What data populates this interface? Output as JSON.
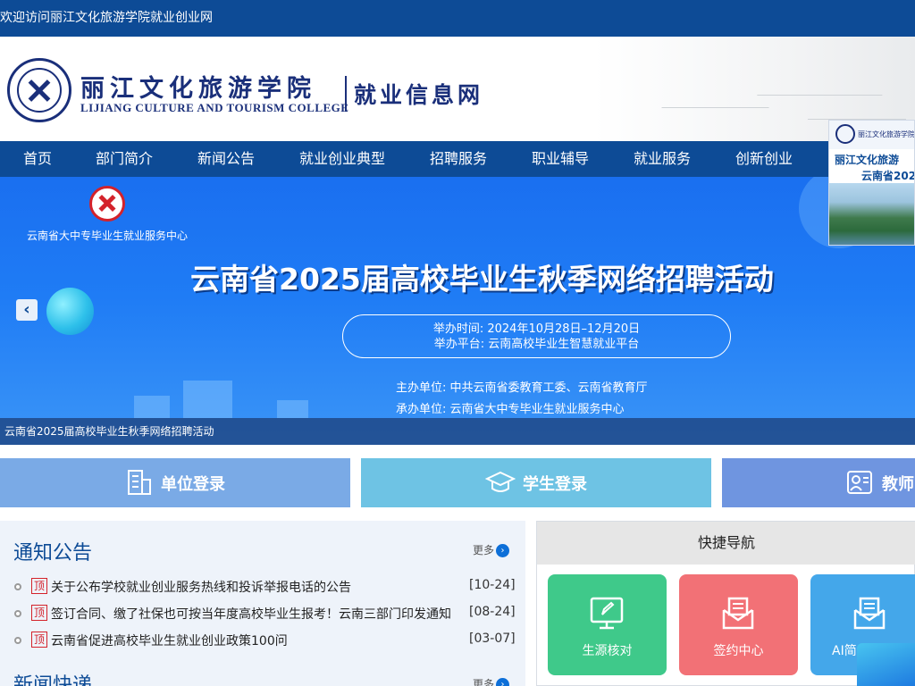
{
  "topbar": {
    "welcome": "欢迎访问丽江文化旅游学院就业创业网"
  },
  "header": {
    "school_cn": "丽江文化旅游学院",
    "school_en": "LIJIANG CULTURE AND TOURISM COLLEGE",
    "site_name": "就业信息网"
  },
  "nav": {
    "items": [
      {
        "label": "首页"
      },
      {
        "label": "部门简介"
      },
      {
        "label": "新闻公告"
      },
      {
        "label": "就业创业典型"
      },
      {
        "label": "招聘服务"
      },
      {
        "label": "职业辅导"
      },
      {
        "label": "就业服务"
      },
      {
        "label": "创新创业"
      }
    ]
  },
  "banner": {
    "org_name": "云南省大中专毕业生就业服务中心",
    "title": "云南省2025届高校毕业生秋季网络招聘活动",
    "time_line": "举办时间: 2024年10月28日–12月20日",
    "platform_line": "举办平台: 云南高校毕业生智慧就业平台",
    "host_line": "主办单位: 中共云南省委教育工委、云南省教育厅",
    "organizer_line": "承办单位: 云南省大中专毕业生就业服务中心",
    "caption": "云南省2025届高校毕业生秋季网络招聘活动",
    "prev_arrow": "‹"
  },
  "side_ad": {
    "mini_name": "丽江文化旅游学院",
    "line1": "丽江文化旅游",
    "line2": "云南省202"
  },
  "login": {
    "unit": {
      "label": "单位登录",
      "color": "#7aaae6"
    },
    "student": {
      "label": "学生登录",
      "color": "#6ec3e4"
    },
    "teacher": {
      "label": "教师",
      "color": "#6f95e0"
    }
  },
  "notices": {
    "title": "通知公告",
    "more": "更多",
    "items": [
      {
        "tag": "顶",
        "text": "关于公布学校就业创业服务热线和投诉举报电话的公告",
        "date": "[10-24]"
      },
      {
        "tag": "顶",
        "text": "签订合同、缴了社保也可按当年度高校毕业生报考！云南三部门印发通知",
        "date": "[08-24]"
      },
      {
        "tag": "顶",
        "text": "云南省促进高校毕业生就业创业政策100问",
        "date": "[03-07]"
      }
    ]
  },
  "news": {
    "title": "新闻快递",
    "more": "更多"
  },
  "quick_nav": {
    "title": "快捷导航",
    "tiles": [
      {
        "label": "生源核对",
        "color": "#3fc98a"
      },
      {
        "label": "签约中心",
        "color": "#f27176"
      },
      {
        "label": "AI简",
        "color": "#44a7ea"
      }
    ]
  },
  "colors": {
    "primary": "#0d4b96",
    "accent_red": "#d4222a",
    "banner_blue": "#1f7cf5"
  }
}
